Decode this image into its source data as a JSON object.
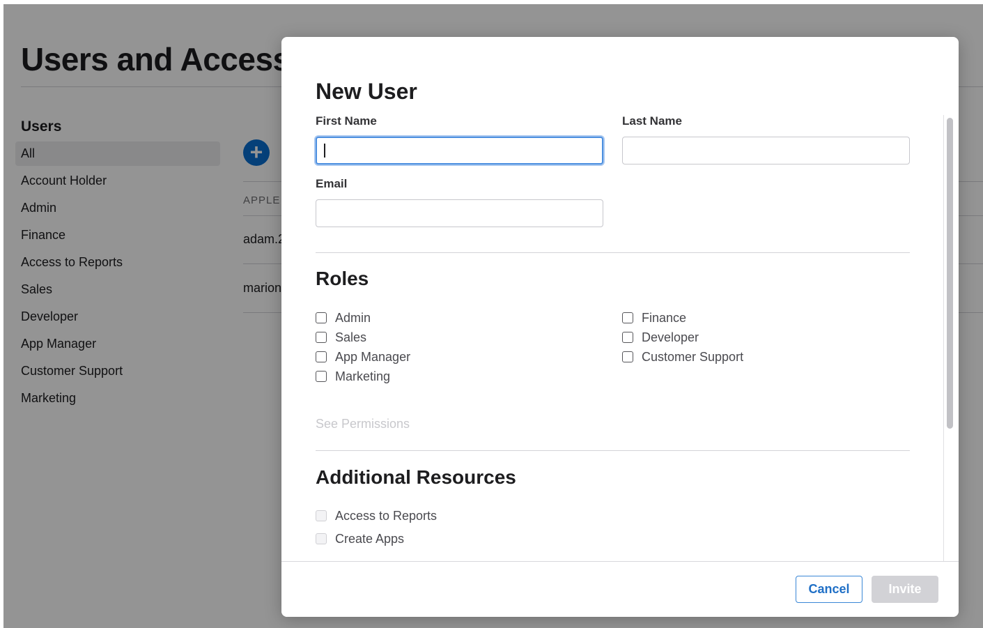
{
  "page": {
    "title": "Users and Access",
    "sidebar": {
      "heading": "Users",
      "items": [
        "All",
        "Account Holder",
        "Admin",
        "Finance",
        "Access to Reports",
        "Sales",
        "Developer",
        "App Manager",
        "Customer Support",
        "Marketing"
      ],
      "active": "All"
    },
    "add_button": "+",
    "table": {
      "column_header": "APPLE",
      "rows": [
        "adam.2",
        "marion"
      ]
    }
  },
  "modal": {
    "title": "New User",
    "first_name": {
      "label": "First Name",
      "value": ""
    },
    "last_name": {
      "label": "Last Name",
      "value": ""
    },
    "email": {
      "label": "Email",
      "value": ""
    },
    "roles": {
      "title": "Roles",
      "left": [
        "Admin",
        "Sales",
        "App Manager",
        "Marketing"
      ],
      "right": [
        "Finance",
        "Developer",
        "Customer Support"
      ]
    },
    "see_permissions": "See Permissions",
    "additional": {
      "title": "Additional Resources",
      "items": [
        "Access to Reports",
        "Create Apps"
      ]
    },
    "cancel_label": "Cancel",
    "invite_label": "Invite"
  },
  "colors": {
    "accent": "#0a6ed1",
    "focus_ring": "#4d90e0",
    "disabled_button": "#d2d2d6"
  }
}
